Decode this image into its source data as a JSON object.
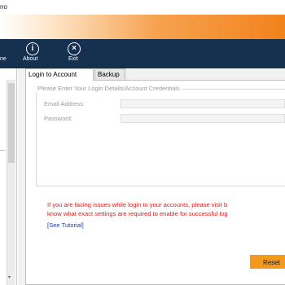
{
  "window": {
    "title_fragment": "no"
  },
  "toolbar": {
    "items": [
      {
        "label": "ne",
        "icon": "home-icon"
      },
      {
        "label": "About",
        "icon": "info-icon"
      },
      {
        "label": "Exit",
        "icon": "close-icon"
      }
    ]
  },
  "tabs": [
    {
      "label": "Login to Account",
      "active": true
    },
    {
      "label": "Backup",
      "active": false
    }
  ],
  "form": {
    "legend": "Please Enter Your Login Details/Account Credentials",
    "email_label": "Email Address:",
    "email_value": "",
    "password_label": "Password:",
    "password_value": ""
  },
  "notice": {
    "line1": "If you are facing issues while login to your accounts, please visit b",
    "line2": "know what exact settings are required to enable for successful log",
    "color": "#e01b1b"
  },
  "tutorial_link": "[See Tutorial]",
  "buttons": {
    "reset": "Reset"
  },
  "colors": {
    "toolbar": "#16304f",
    "accent": "#f39a1e",
    "banner_end": "#f2821c"
  }
}
